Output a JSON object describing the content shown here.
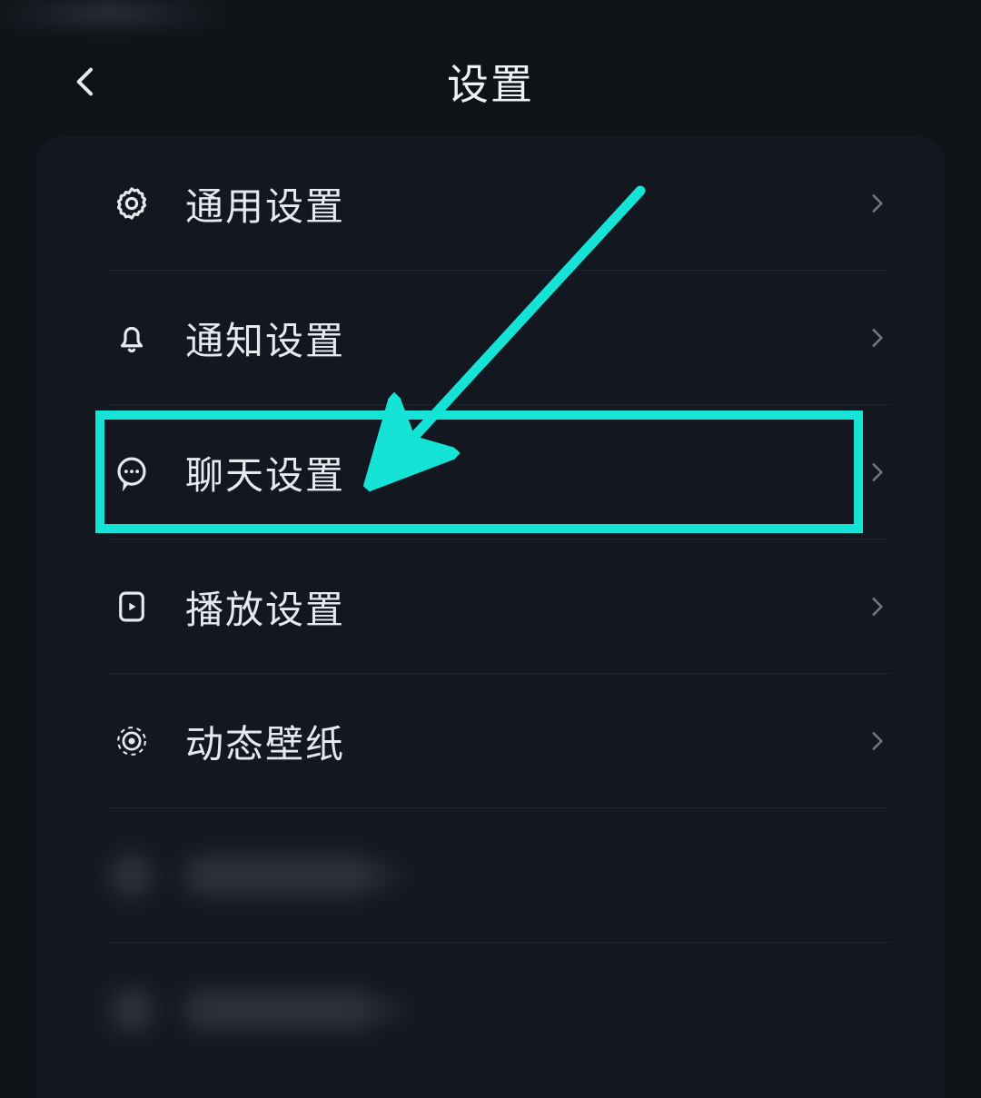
{
  "header": {
    "title": "设置"
  },
  "annotation": {
    "color": "#14e3d6",
    "target_index": 2
  },
  "settings": {
    "items": [
      {
        "icon": "gear-icon",
        "label": "通用设置"
      },
      {
        "icon": "bell-icon",
        "label": "通知设置"
      },
      {
        "icon": "chat-icon",
        "label": "聊天设置"
      },
      {
        "icon": "play-icon",
        "label": "播放设置"
      },
      {
        "icon": "wallpaper-icon",
        "label": "动态壁纸"
      },
      {
        "icon": "blur-icon",
        "label": "",
        "blurred": true
      },
      {
        "icon": "blur-icon",
        "label": "",
        "blurred": true
      }
    ]
  }
}
